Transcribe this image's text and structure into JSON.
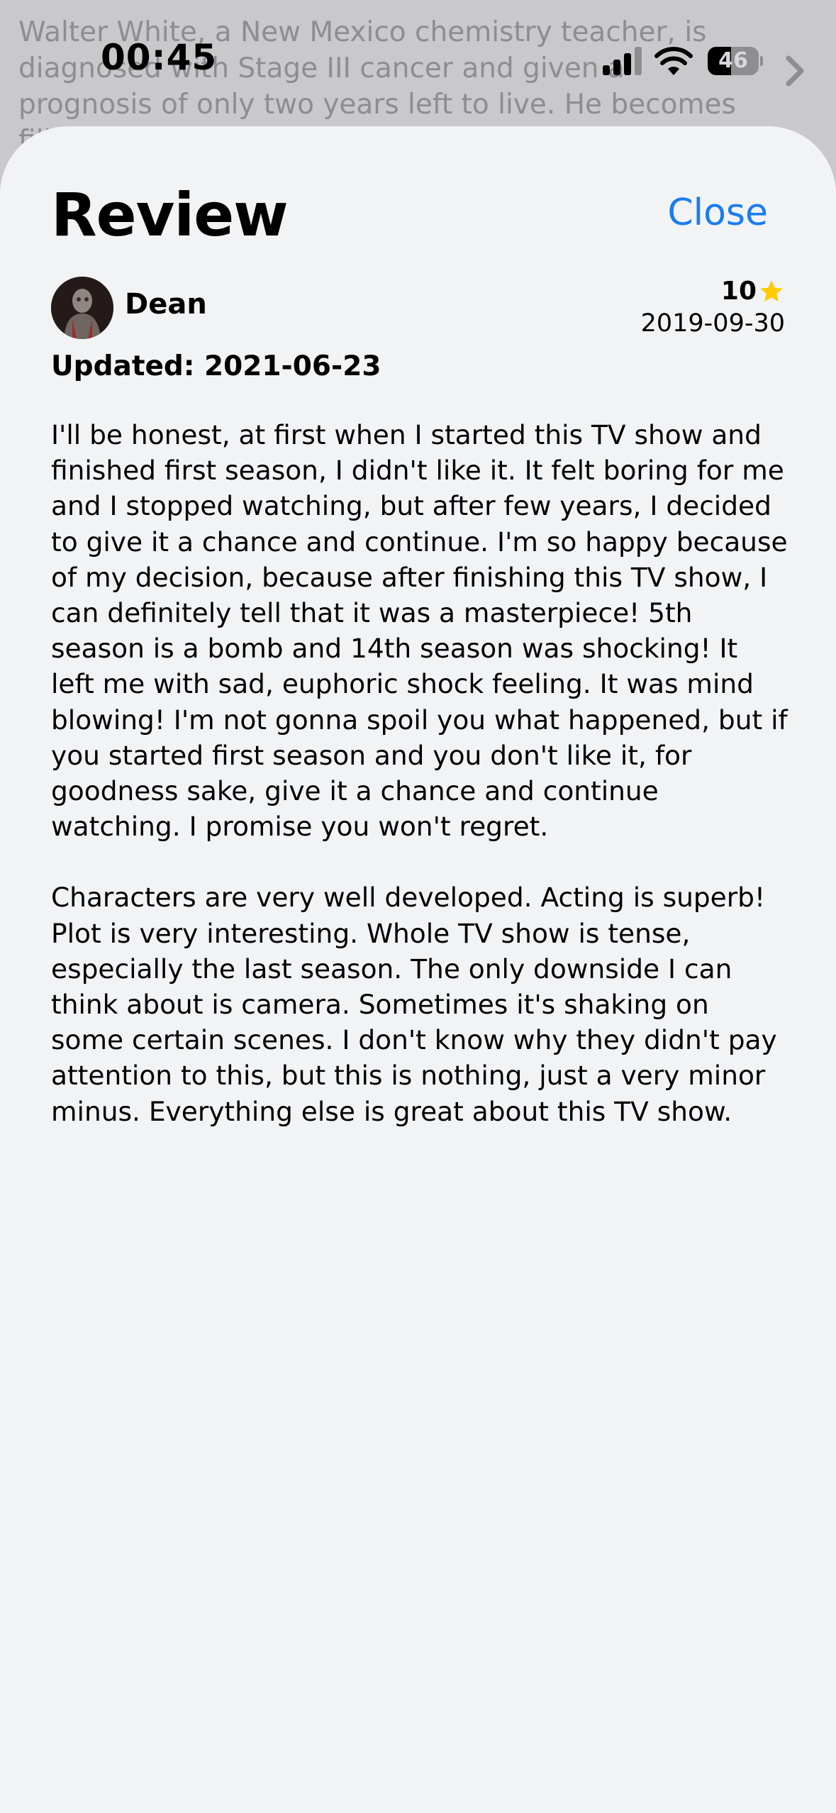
{
  "background": {
    "synopsis": "Walter White, a New Mexico chemistry teacher, is diagnosed with Stage III cancer and given a prognosis of only two years left to live. He becomes filled with..."
  },
  "status_bar": {
    "time": "00:45",
    "battery_level": "46",
    "battery_fraction": 0.46
  },
  "sheet": {
    "title": "Review",
    "close_label": "Close"
  },
  "review": {
    "author": "Dean",
    "rating": "10",
    "date": "2019-09-30",
    "updated": "Updated: 2021-06-23",
    "paragraphs": [
      "I'll be honest, at first when I started this TV show and finished first season, I didn't like it. It felt boring for me and I stopped watching, but after few years, I decided to give it a chance and continue. I'm so happy because of my decision, because after finishing this TV show, I can definitely tell that it was a masterpiece! 5th season is a bomb and 14th season was shocking! It left me with sad, euphoric shock feeling. It was mind blowing! I'm not gonna spoil you what happened, but if you started first season and you don't like it, for goodness sake, give it a chance and continue watching. I promise you won't regret.",
      "Characters are very well developed. Acting is superb! Plot is very interesting. Whole TV show is tense, especially the last season. The only downside I can think about is camera. Sometimes it's shaking on some certain scenes. I don't know why they didn't pay attention to this, but this is nothing, just a very minor minus. Everything else is great about this TV show."
    ]
  },
  "colors": {
    "accent": "#1a7cf0",
    "star": "#ffcc00",
    "sheet_background": "#f2f3f5"
  },
  "icons": {
    "signal": "cellular-signal-icon",
    "wifi": "wifi-icon",
    "battery": "battery-icon",
    "star": "star-icon",
    "chevron": "chevron-right-icon"
  }
}
